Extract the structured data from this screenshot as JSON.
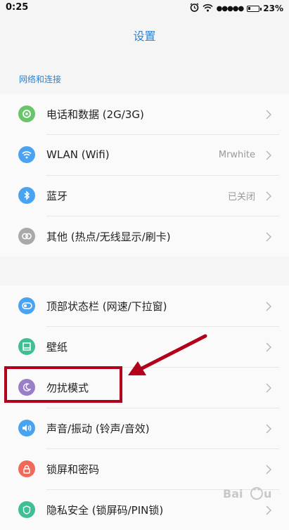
{
  "status_bar": {
    "time": "0:25",
    "signal": "●●●●●",
    "battery_percent": "23%",
    "battery_level": 0.23
  },
  "nav": {
    "title": "设置"
  },
  "section": {
    "title": "网络和连接"
  },
  "groups": [
    {
      "items": [
        {
          "label": "电话和数据 (2G/3G)",
          "value": "",
          "icon": "phone-data-icon",
          "color": "#6ac56a"
        },
        {
          "label": "WLAN (Wifi)",
          "value": "Mrwhite",
          "icon": "wifi-icon",
          "color": "#4aa3f0"
        },
        {
          "label": "蓝牙",
          "value": "已关闭",
          "icon": "bluetooth-icon",
          "color": "#4aa3f0"
        },
        {
          "label": "其他 (热点/无线显示/刷卡)",
          "value": "",
          "icon": "link-icon",
          "color": "#a9a9a9"
        }
      ]
    },
    {
      "items": [
        {
          "label": "顶部状态栏 (网速/下拉窗)",
          "value": "",
          "icon": "toggle-icon",
          "color": "#4aa3f0"
        },
        {
          "label": "壁纸",
          "value": "",
          "icon": "wallpaper-icon",
          "color": "#3fbf95"
        },
        {
          "label": "勿扰模式",
          "value": "",
          "icon": "moon-icon",
          "color": "#9a7fc7"
        },
        {
          "label": "声音/振动 (铃声/音效)",
          "value": "",
          "icon": "speaker-icon",
          "color": "#4aa3f0"
        },
        {
          "label": "锁屏和密码",
          "value": "",
          "icon": "lock-icon",
          "color": "#f06a5a"
        },
        {
          "label": "隐私安全 (锁屏码/PIN锁)",
          "value": "",
          "icon": "shield-icon",
          "color": "#3fbf95"
        }
      ]
    }
  ],
  "colors": {
    "accent": "#2c82d6",
    "highlight": "#b3001b"
  }
}
